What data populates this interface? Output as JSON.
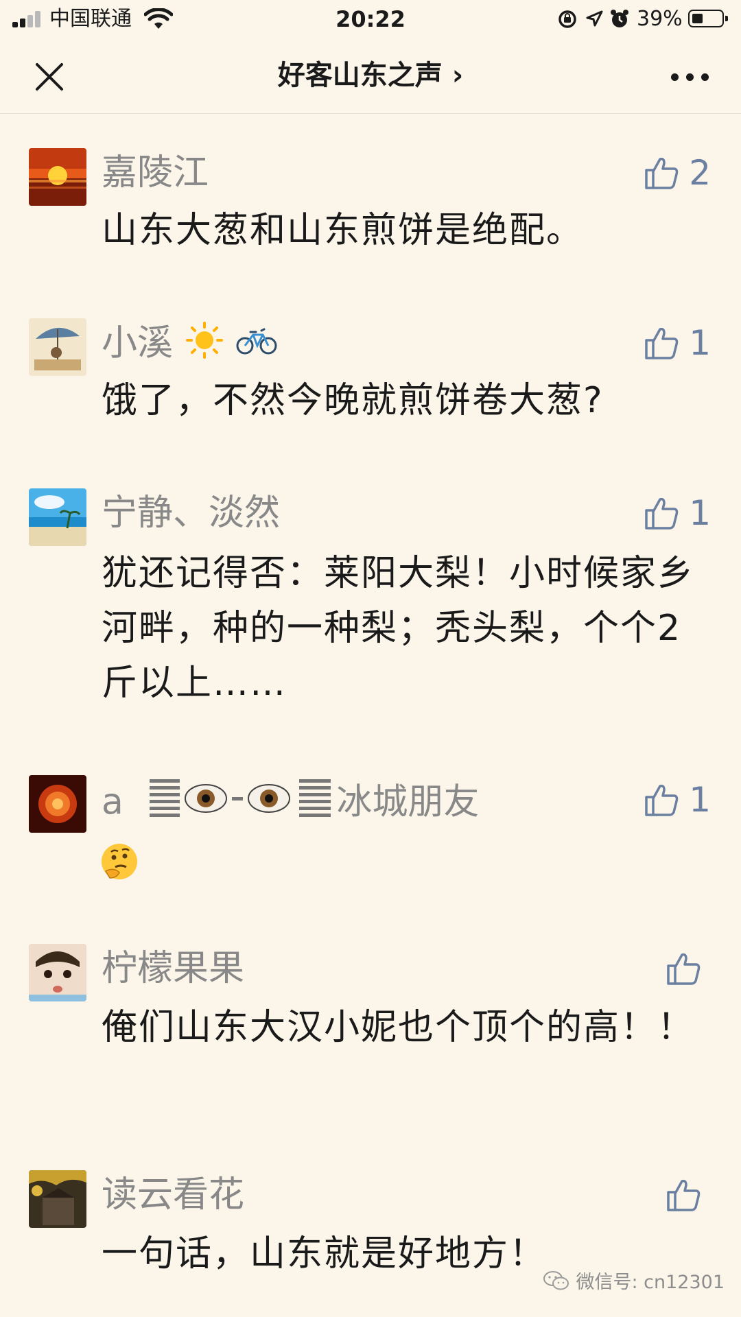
{
  "status_bar": {
    "carrier": "中国联通",
    "time": "20:22",
    "battery": "39%",
    "battery_level": 0.39
  },
  "nav": {
    "title": "好客山东之声 ›"
  },
  "comments": [
    {
      "name": "嘉陵江",
      "likes": "2",
      "text": "山东大葱和山东煎饼是绝配。"
    },
    {
      "name": "小溪",
      "likes": "1",
      "text": "饿了，不然今晚就煎饼卷大葱?"
    },
    {
      "name": "宁静、淡然",
      "likes": "1",
      "text": "犹还记得否：莱阳大梨！小时候家乡河畔，种的一种梨；秃头梨，个个2斤以上……"
    },
    {
      "name": "a  ",
      "name_suffix": "冰城朋友",
      "likes": "1",
      "text": ""
    },
    {
      "name": "柠檬果果",
      "likes": "",
      "text": "俺们山东大汉小妮也个顶个的高！！"
    },
    {
      "name": "读云看花",
      "likes": "",
      "text": "一句话，山东就是好地方！"
    }
  ],
  "watermark": "微信号: cn12301",
  "icons": [
    "signal-icon",
    "wifi-icon",
    "close-icon",
    "more-icon",
    "thumb-up-icon",
    "sun-emoji",
    "bicycle-emoji",
    "eye-emoji",
    "thinking-emoji",
    "wechat-icon"
  ]
}
